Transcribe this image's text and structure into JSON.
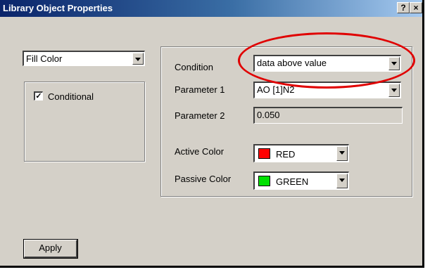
{
  "window": {
    "title": "Library Object Properties",
    "help_label": "?",
    "close_label": "×"
  },
  "left_panel": {
    "property_select": "Fill Color",
    "conditional_label": "Conditional",
    "conditional_checked": true,
    "checkmark": "✓"
  },
  "right_panel": {
    "condition_label": "Condition",
    "condition_value": "data above value",
    "parameter1_label": "Parameter 1",
    "parameter1_value": "AO  [1]N2",
    "parameter2_label": "Parameter 2",
    "parameter2_value": "0.050",
    "active_color_label": "Active Color",
    "active_color_value": "RED",
    "active_color_hex": "#ff0000",
    "passive_color_label": "Passive Color",
    "passive_color_value": "GREEN",
    "passive_color_hex": "#00e000"
  },
  "footer": {
    "apply_label": "Apply"
  },
  "annotation": {
    "highlight_color": "#e00000"
  }
}
